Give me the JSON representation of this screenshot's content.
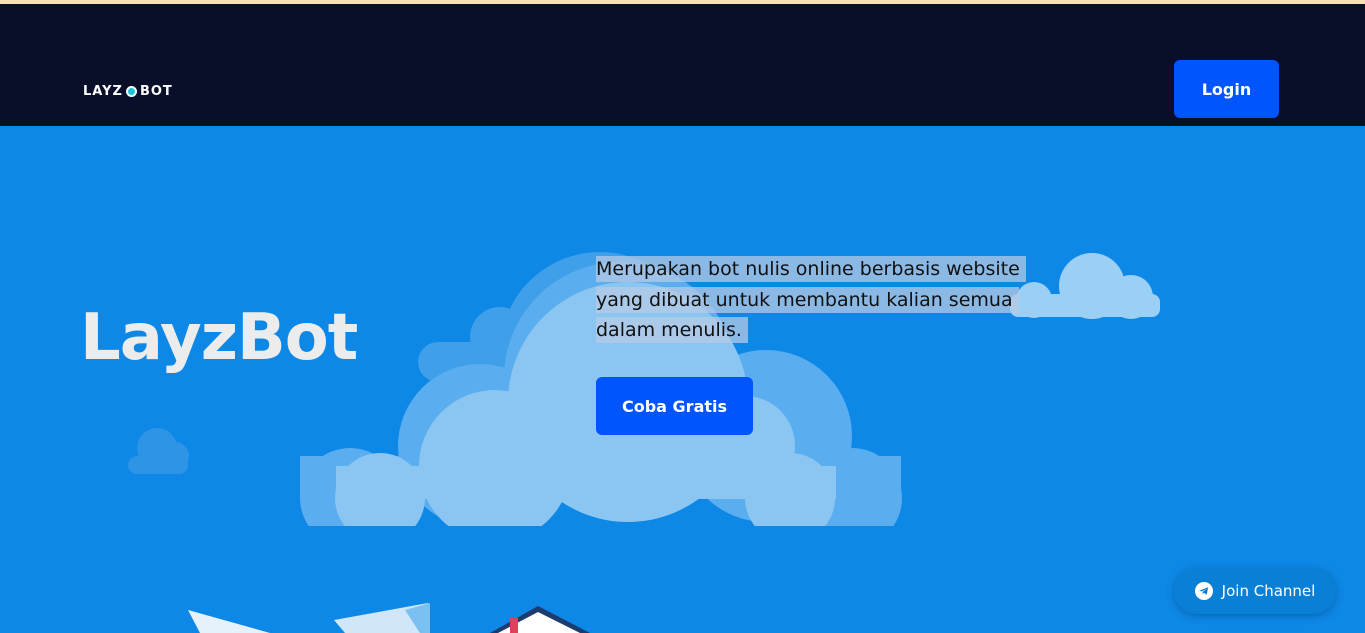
{
  "navbar": {
    "logo_left": "LAYZ",
    "logo_right": "BOT",
    "login_label": "Login"
  },
  "hero": {
    "title": "LayzBot",
    "description_lines": [
      "Merupakan bot nulis online berbasis website",
      "yang dibuat untuk membantu kalian semua",
      "dalam menulis."
    ],
    "cta_label": "Coba Gratis"
  },
  "floating": {
    "join_label": "Join Channel",
    "icon": "telegram-icon"
  },
  "colors": {
    "navbar_bg": "#090e29",
    "hero_bg": "#0d88e6",
    "button_primary": "#0055fc",
    "top_stripe": "#f6dfb7"
  }
}
